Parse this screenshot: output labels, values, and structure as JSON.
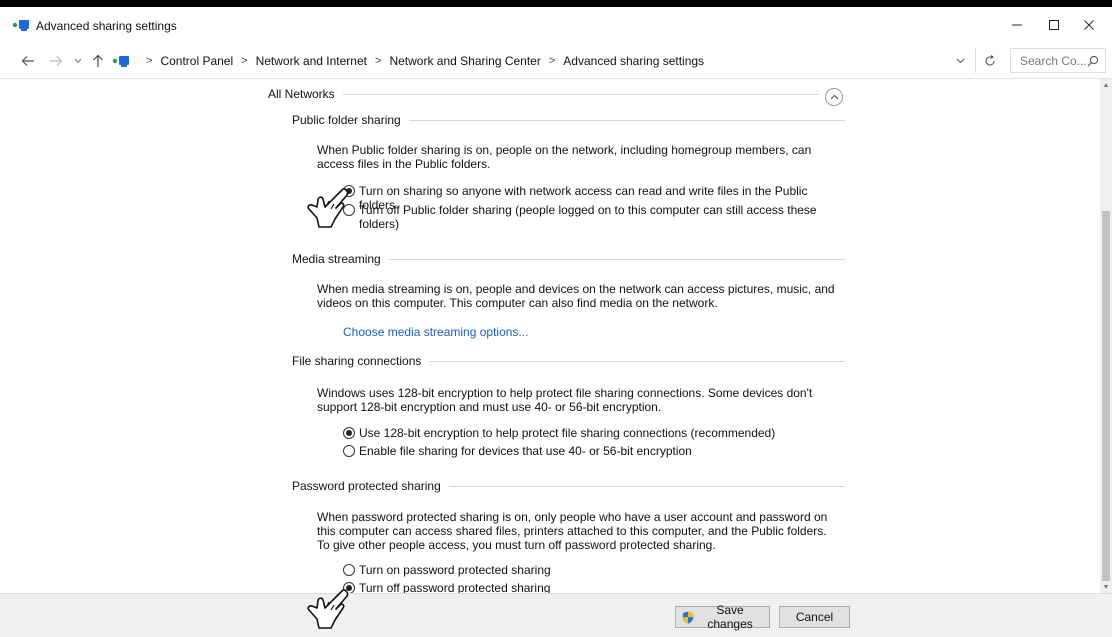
{
  "window": {
    "title": "Advanced sharing settings",
    "minimize_icon": "minimize-icon",
    "maximize_icon": "maximize-icon",
    "close_icon": "close-icon"
  },
  "address_bar": {
    "breadcrumbs": [
      "Control Panel",
      "Network and Internet",
      "Network and Sharing Center",
      "Advanced sharing settings"
    ],
    "search_placeholder": "Search Co..."
  },
  "profile": {
    "title": "All Networks"
  },
  "sections": {
    "public_folder": {
      "title": "Public folder sharing",
      "description": "When Public folder sharing is on, people on the network, including homegroup members, can access files in the Public folders.",
      "options": [
        {
          "label": "Turn on sharing so anyone with network access can read and write files in the Public folders",
          "selected": true
        },
        {
          "label": "Turn off Public folder sharing (people logged on to this computer can still access these folders)",
          "selected": false
        }
      ]
    },
    "media_streaming": {
      "title": "Media streaming",
      "description": "When media streaming is on, people and devices on the network can access pictures, music, and videos on this computer. This computer can also find media on the network.",
      "link": "Choose media streaming options..."
    },
    "file_sharing": {
      "title": "File sharing connections",
      "description": "Windows uses 128-bit encryption to help protect file sharing connections. Some devices don't support 128-bit encryption and must use 40- or 56-bit encryption.",
      "options": [
        {
          "label": "Use 128-bit encryption to help protect file sharing connections (recommended)",
          "selected": true
        },
        {
          "label": "Enable file sharing for devices that use 40- or 56-bit encryption",
          "selected": false
        }
      ]
    },
    "password_sharing": {
      "title": "Password protected sharing",
      "description": "When password protected sharing is on, only people who have a user account and password on this computer can access shared files, printers attached to this computer, and the Public folders. To give other people access, you must turn off password protected sharing.",
      "options": [
        {
          "label": "Turn on password protected sharing",
          "selected": false
        },
        {
          "label": "Turn off password protected sharing",
          "selected": true
        }
      ]
    }
  },
  "footer": {
    "save_label": "Save changes",
    "cancel_label": "Cancel"
  },
  "colors": {
    "link": "#1a5fb4",
    "shield_blue": "#2b6fcf",
    "shield_yellow": "#f2c12e"
  }
}
